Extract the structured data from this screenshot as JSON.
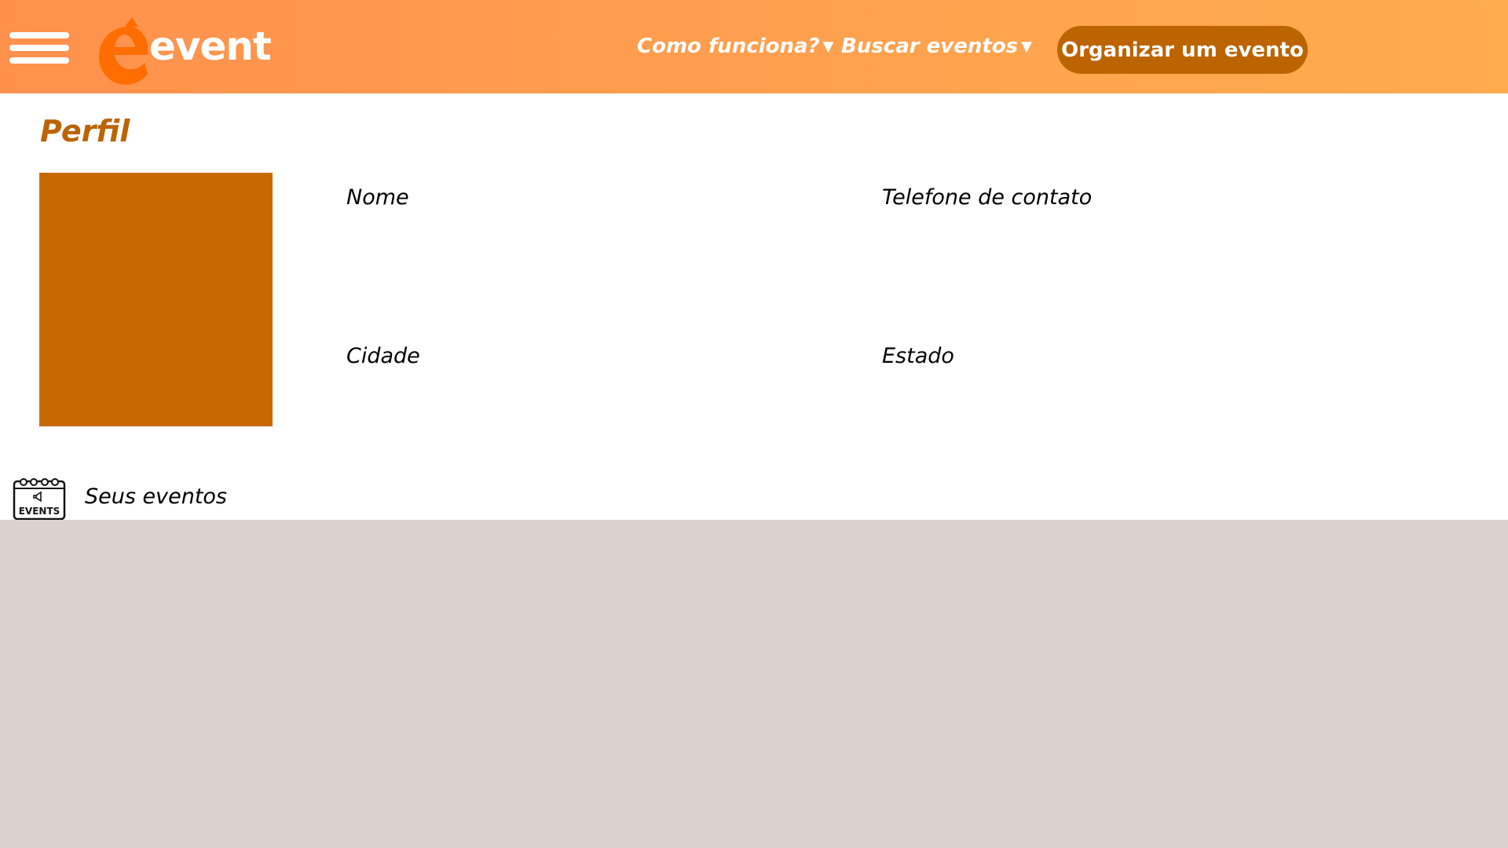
{
  "header": {
    "logo_text": "event",
    "nav": {
      "como_funciona": "Como funciona?",
      "buscar_eventos": "Buscar eventos"
    },
    "cta_label": "Organizar um evento"
  },
  "profile": {
    "title": "Perfil",
    "fields": {
      "nome": "Nome",
      "telefone": "Telefone de contato",
      "cidade": "Cidade",
      "estado": "Estado"
    }
  },
  "events_section": {
    "label": "Seus eventos",
    "icon_text": "EVENTS"
  },
  "colors": {
    "header_gradient_start": "#ff914d",
    "header_gradient_end": "#ffab4e",
    "accent": "#bb6400",
    "avatar_placeholder": "#c66a00",
    "bottom_background": "#dbd2cd"
  },
  "icons": {
    "menu": "hamburger-menu-icon",
    "logo": "event-logo-icon",
    "dropdown": "caret-down-icon",
    "events": "events-calendar-icon"
  }
}
